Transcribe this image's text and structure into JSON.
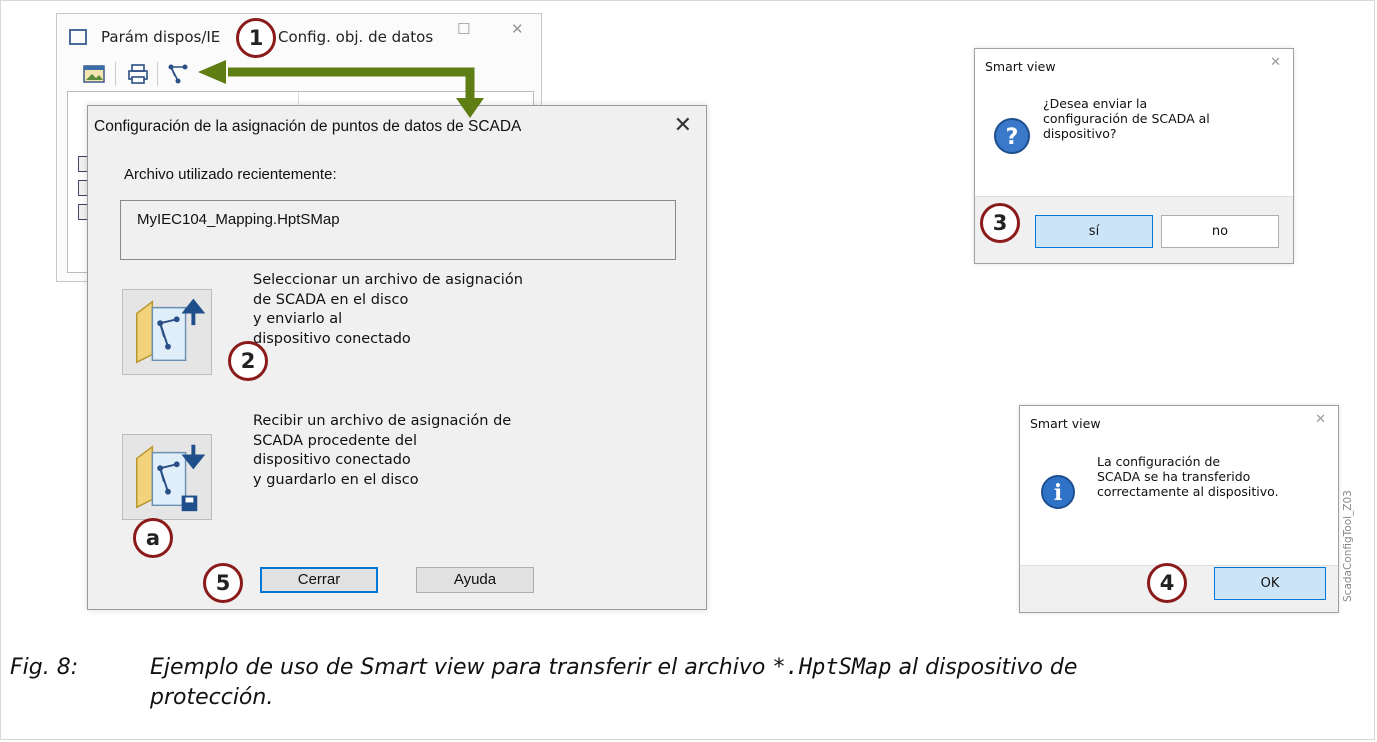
{
  "main_window": {
    "title_left": "Parám dispos/IE",
    "title_right": "Config. obj. de datos"
  },
  "scada_dialog": {
    "title": "Configuración de la asignación de puntos de datos de SCADA",
    "recent_label": "Archivo utilizado recientemente:",
    "recent_file": "MyIEC104_Mapping.HptSMap",
    "send_option_text": "Seleccionar un archivo de asignación\nde SCADA en el disco\ny enviarlo al\ndispositivo conectado",
    "receive_option_text": "Recibir un archivo de asignación de\nSCADA procedente del\ndispositivo conectado\ny guardarlo en el disco",
    "close_button": "Cerrar",
    "help_button": "Ayuda"
  },
  "confirm_box": {
    "title": "Smart view",
    "message": "¿Desea enviar la\nconfiguración de SCADA al\ndispositivo?",
    "yes_button": "sí",
    "no_button": "no"
  },
  "info_box": {
    "title": "Smart view",
    "message": "La configuración de\nSCADA se ha transferido\ncorrectamente al dispositivo.",
    "ok_button": "OK"
  },
  "callouts": {
    "c1": "1",
    "c2": "2",
    "c3": "3",
    "c4": "4",
    "c5": "5",
    "ca": "a"
  },
  "caption": {
    "number": "Fig. 8:",
    "text_before": "Ejemplo de uso de Smart view para transferir el archivo ",
    "code": "*.HptSMap",
    "text_after": " al dispositivo de",
    "line2": "protección."
  },
  "side_label": "ScadaConfigTool_Z03",
  "colors": {
    "callout_border": "#8b1a1a",
    "arrow": "#5e7d12",
    "selected_button": "#cce4f7",
    "default_border": "#0078d7"
  }
}
